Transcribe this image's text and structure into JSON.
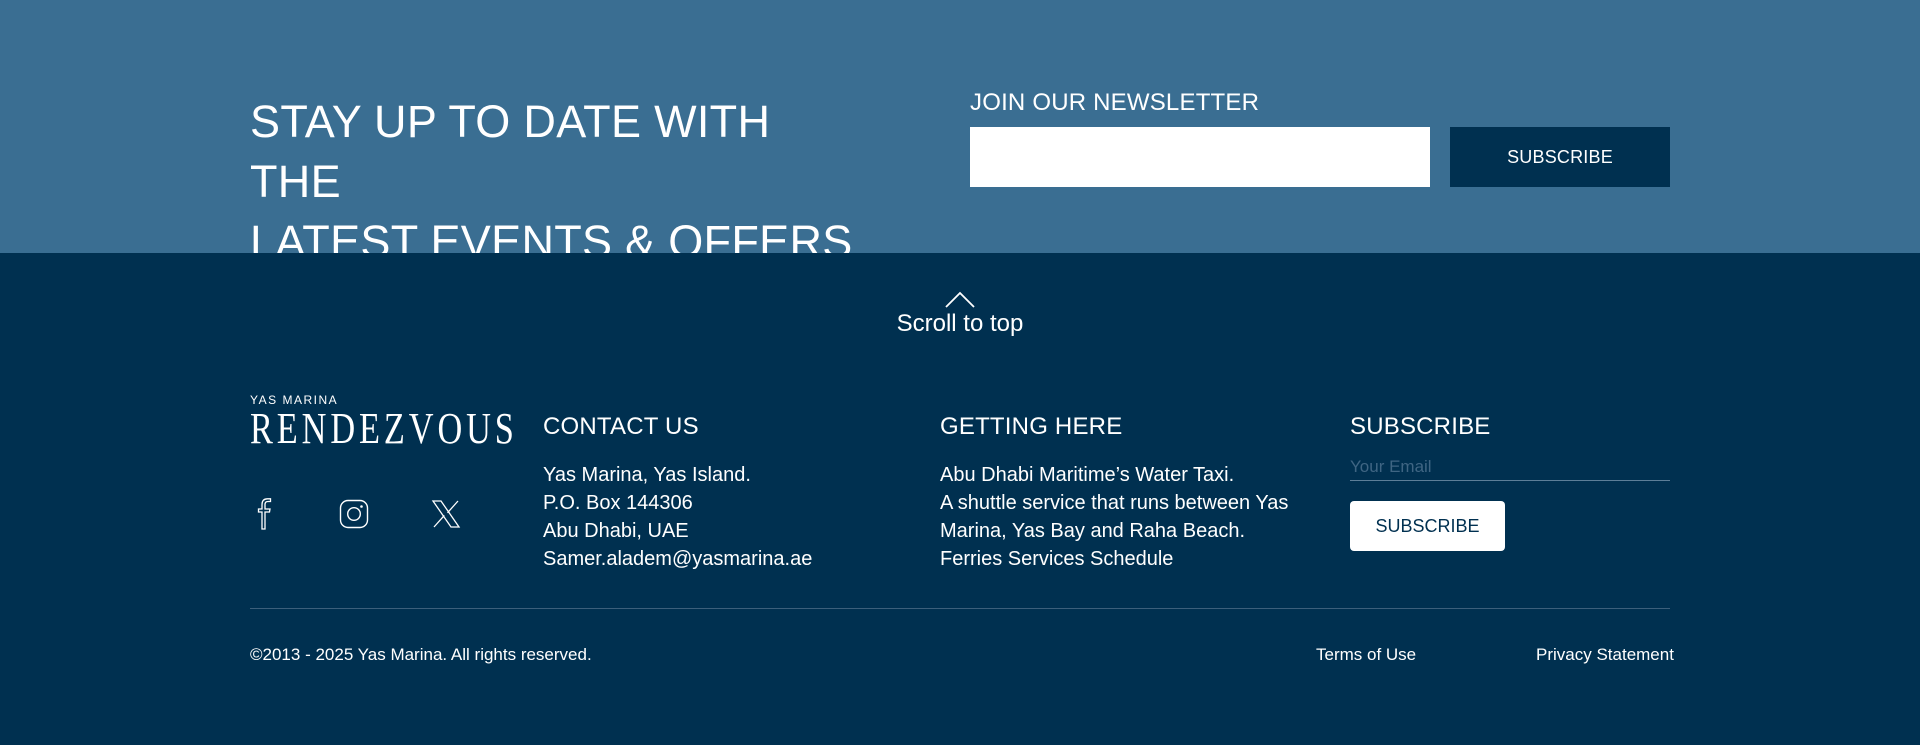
{
  "newsletter": {
    "headline_line1": "STAY UP TO DATE WITH THE",
    "headline_line2": "LATEST EVENTS & OFFERS",
    "join_label": "JOIN OUR NEWSLETTER",
    "email_value": "",
    "subscribe_label": "SUBSCRIBE",
    "background_color": "#3a6e92",
    "button_color": "#003050"
  },
  "scroll_top": {
    "label": "Scroll to top",
    "icon": "chevron-up-icon"
  },
  "brand": {
    "small_text": "YAS MARINA",
    "large_text": "RENDEZVOUS"
  },
  "socials": [
    {
      "name": "facebook",
      "icon": "facebook-icon"
    },
    {
      "name": "instagram",
      "icon": "instagram-icon"
    },
    {
      "name": "x",
      "icon": "x-icon"
    }
  ],
  "contact": {
    "title": "CONTACT US",
    "lines": [
      "Yas Marina, Yas Island.",
      "P.O. Box 144306",
      "Abu Dhabi, UAE",
      "Samer.aladem@yasmarina.ae"
    ]
  },
  "getting_here": {
    "title": "GETTING HERE",
    "line1": "Abu Dhabi Maritime’s Water Taxi.",
    "line2": "A shuttle service that runs between Yas Marina, Yas Bay and Raha Beach.",
    "line3": "Ferries Services Schedule"
  },
  "footer_subscribe": {
    "title": "SUBSCRIBE",
    "placeholder": "Your Email",
    "button_label": "SUBSCRIBE"
  },
  "legal": {
    "copyright": "©2013 - 2025 Yas Marina. All rights reserved.",
    "terms": "Terms of Use",
    "privacy": "Privacy Statement"
  },
  "colors": {
    "footer_background": "#003050",
    "text": "#ffffff",
    "divider": "#3c5f7b"
  }
}
